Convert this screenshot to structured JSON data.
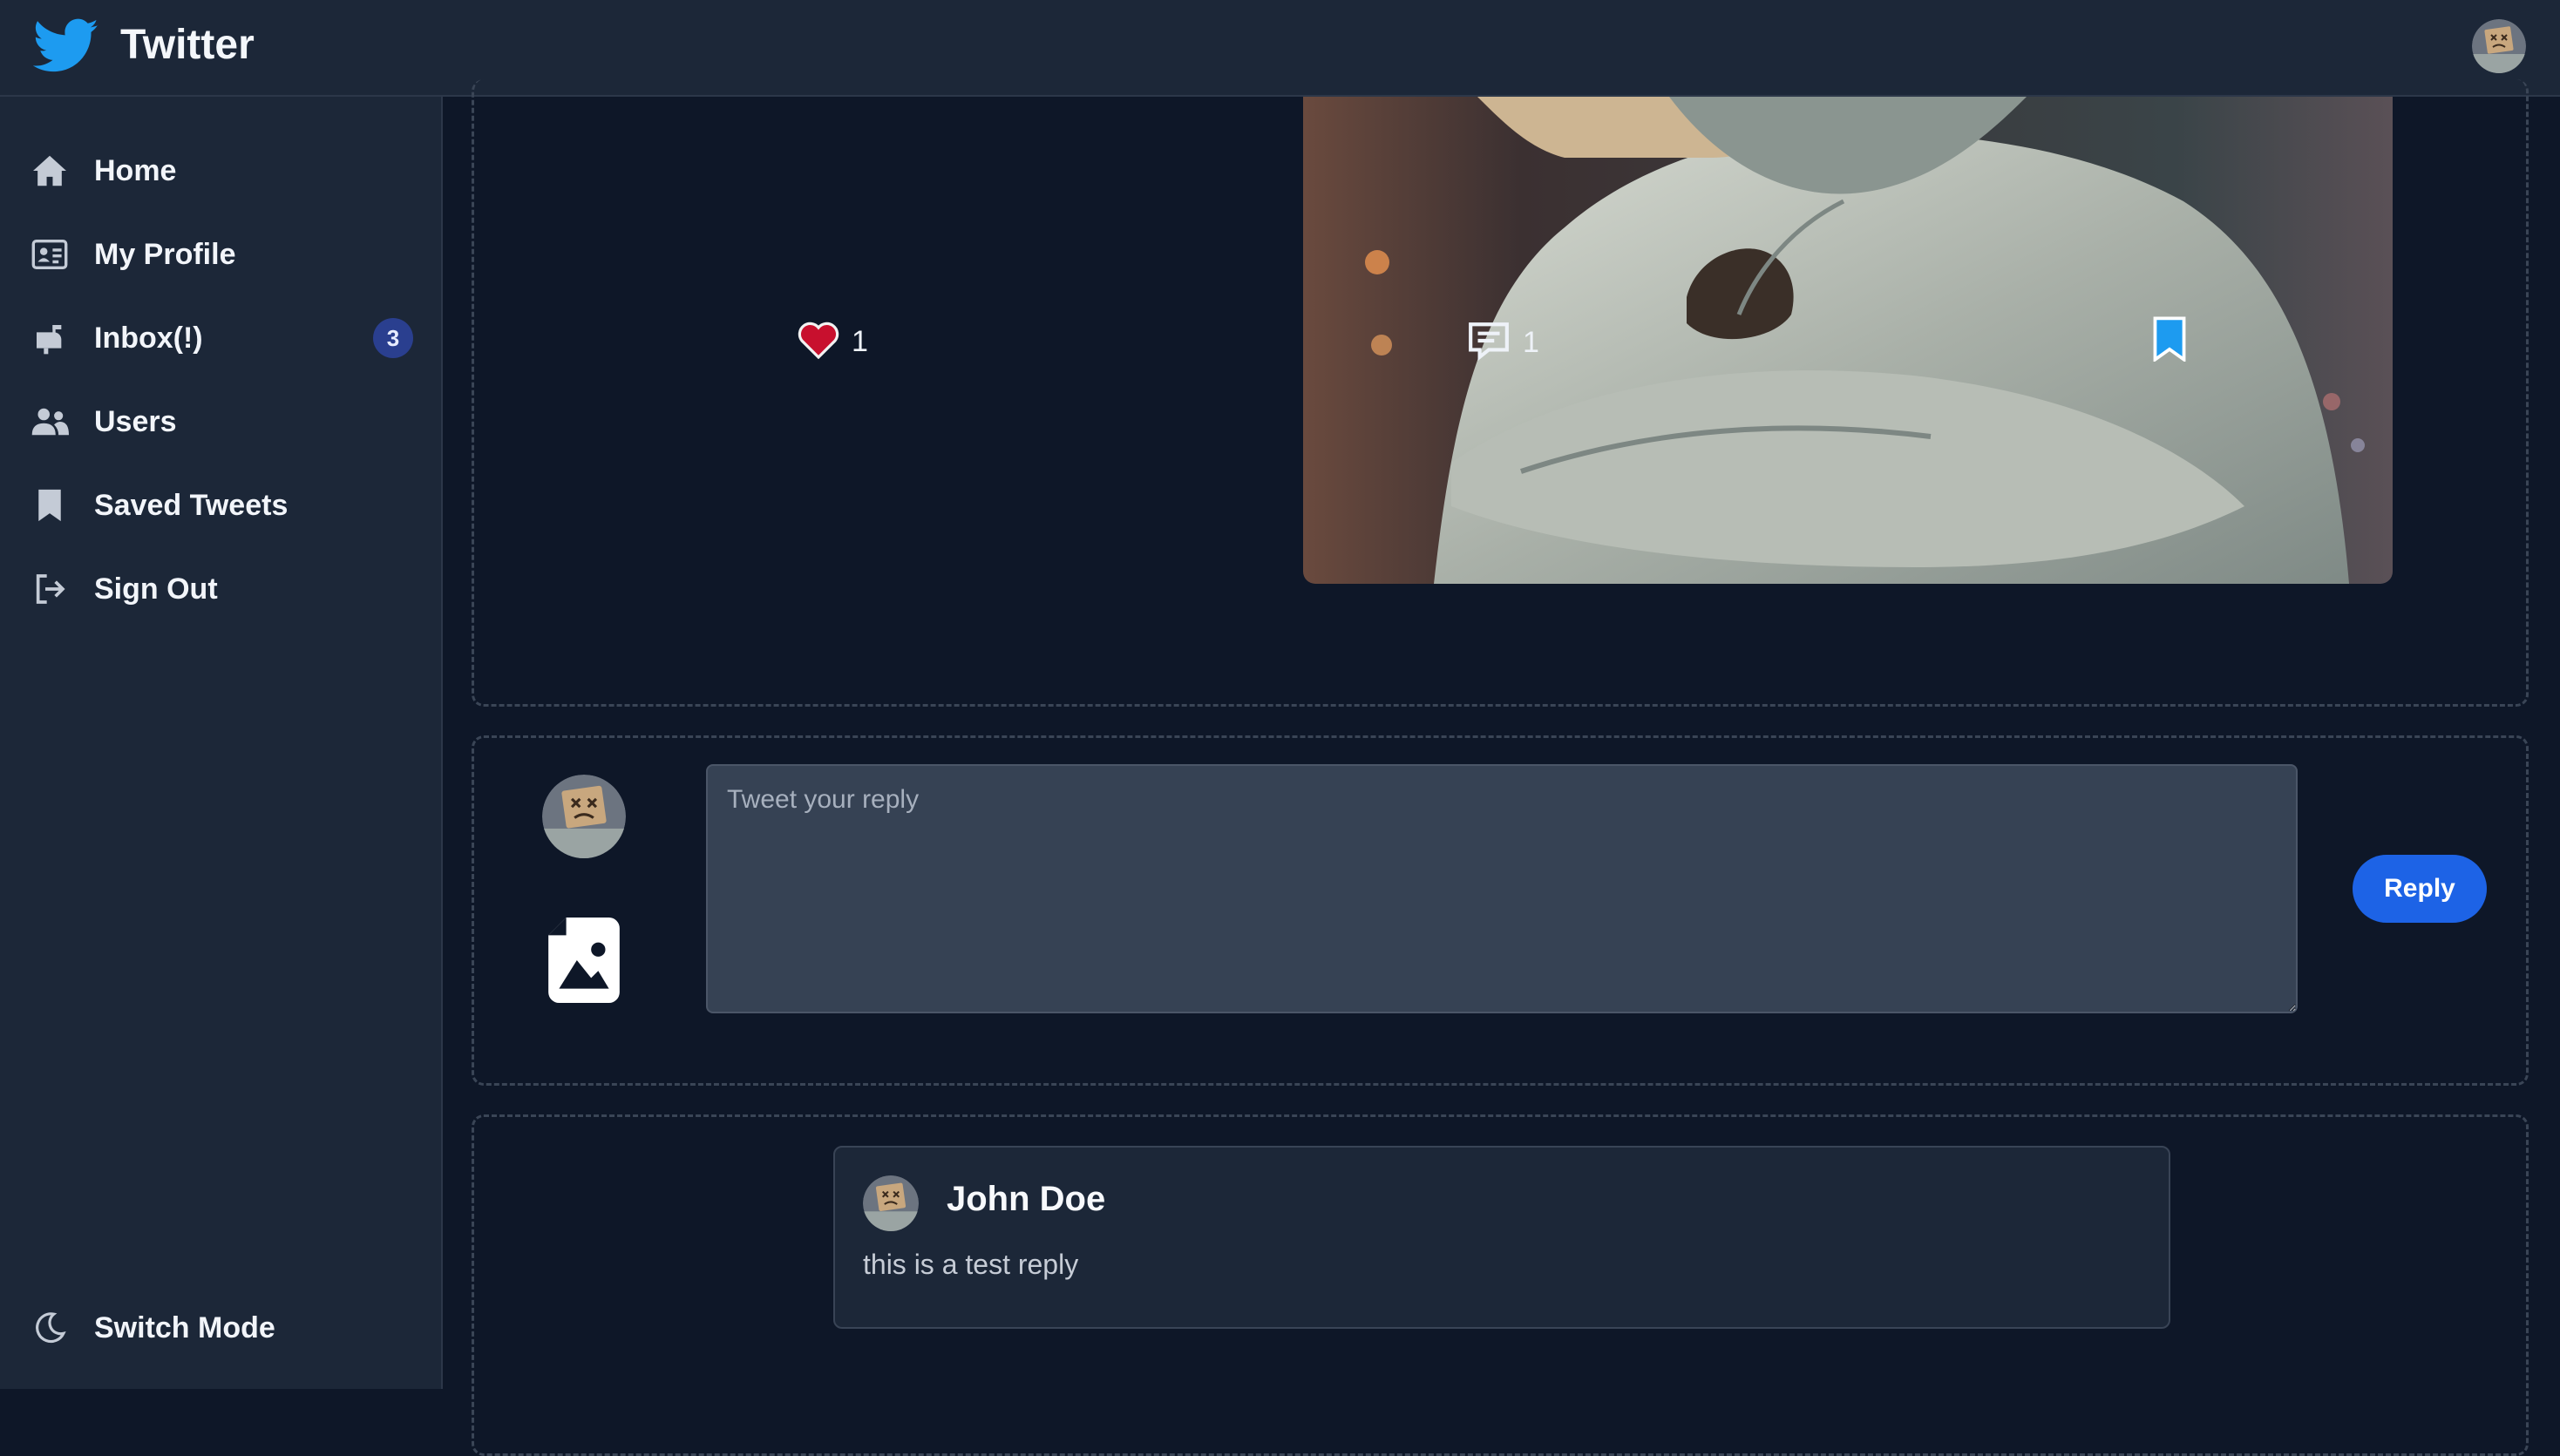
{
  "app": {
    "title": "Twitter",
    "brand_color": "#1d9bf0"
  },
  "header": {
    "user_avatar": "user-avatar"
  },
  "sidebar": {
    "items": [
      {
        "label": "Home",
        "icon": "home-icon"
      },
      {
        "label": "My Profile",
        "icon": "id-card-icon"
      },
      {
        "label": "Inbox(!)",
        "icon": "mailbox-icon",
        "badge": "3"
      },
      {
        "label": "Users",
        "icon": "users-icon"
      },
      {
        "label": "Saved Tweets",
        "icon": "bookmark-icon"
      },
      {
        "label": "Sign Out",
        "icon": "sign-out-icon"
      }
    ],
    "switch_mode": {
      "label": "Switch Mode",
      "icon": "moon-icon"
    }
  },
  "tweet": {
    "likes": "1",
    "comments": "1",
    "like_color": "#c8102e",
    "bookmark_color": "#1d9bf0"
  },
  "reply_form": {
    "placeholder": "Tweet your reply",
    "value": "",
    "button_label": "Reply",
    "button_color": "#1d63e6"
  },
  "replies": [
    {
      "author": "John Doe",
      "text": "this is a test reply"
    }
  ]
}
